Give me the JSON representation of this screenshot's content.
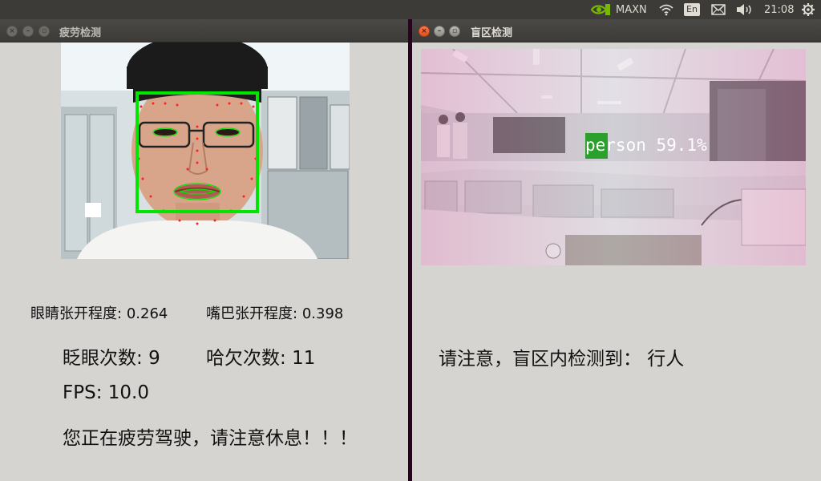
{
  "system_panel": {
    "power_mode": "MAXN",
    "language": "En",
    "time": "21:08",
    "icons": [
      "nvidia-icon",
      "wifi-icon",
      "keyboard-language-icon",
      "mail-icon",
      "volume-icon",
      "settings-gear-icon"
    ]
  },
  "left_window": {
    "title": "疲劳检测",
    "eye_openness_label": "眼睛张开程度:",
    "eye_openness_value": "0.264",
    "mouth_openness_label": "嘴巴张开程度:",
    "mouth_openness_value": "0.398",
    "blink_label": "眨眼次数:",
    "blink_value": "9",
    "yawn_label": "哈欠次数:",
    "yawn_value": "11",
    "fps_label": "FPS:",
    "fps_value": "10.0",
    "warning": "您正在疲劳驾驶，请注意休息！！！"
  },
  "right_window": {
    "title": "盲区检测",
    "detection_label": "person 59.1%",
    "notice": "请注意，盲区内检测到： 行人"
  },
  "colors": {
    "face_box": "#00e600",
    "landmark": "#ff2020",
    "detection_box": "#2ca02c"
  }
}
